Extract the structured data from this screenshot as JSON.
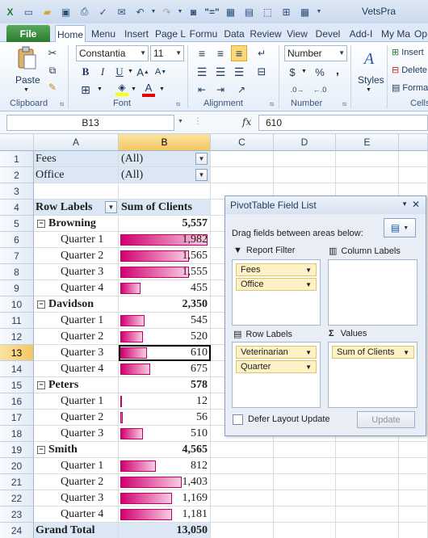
{
  "window": {
    "title": "VetsPra"
  },
  "tabs": [
    {
      "label": "File"
    },
    {
      "label": "Home"
    },
    {
      "label": "Menu"
    },
    {
      "label": "Insert"
    },
    {
      "label": "Page L"
    },
    {
      "label": "Formu"
    },
    {
      "label": "Data"
    },
    {
      "label": "Review"
    },
    {
      "label": "View"
    },
    {
      "label": "Devel"
    },
    {
      "label": "Add-I"
    },
    {
      "label": "My Ma"
    },
    {
      "label": "Op"
    }
  ],
  "ribbon": {
    "font_name": "Constantia",
    "font_size": "11",
    "number_format": "Number",
    "paste_label": "Paste",
    "styles_label": "Styles",
    "insert_label": "Insert",
    "delete_label": "Delete",
    "format_label": "Format",
    "groups": {
      "clipboard": "Clipboard",
      "font": "Font",
      "alignment": "Alignment",
      "number": "Number",
      "cells": "Cells"
    },
    "bold": "B",
    "italic": "I",
    "underline": "U",
    "percent": "%",
    "comma": ","
  },
  "formula_bar": {
    "name_box": "B13",
    "fx": "fx",
    "value": "610"
  },
  "columns": [
    "A",
    "B",
    "C",
    "D",
    "E"
  ],
  "rows": [
    "1",
    "2",
    "3",
    "4",
    "5",
    "6",
    "7",
    "8",
    "9",
    "10",
    "11",
    "12",
    "13",
    "14",
    "15",
    "16",
    "17",
    "18",
    "19",
    "20",
    "21",
    "22",
    "23",
    "24"
  ],
  "filters": [
    {
      "field": "Fees",
      "value": "(All)"
    },
    {
      "field": "Office",
      "value": "(All)"
    }
  ],
  "table": {
    "row_labels": "Row Labels",
    "sum_header": "Sum of Clients",
    "rows": [
      {
        "label": "Browning",
        "value": "5,557",
        "group": true
      },
      {
        "label": "Quarter 1",
        "value": "1,982",
        "frac": 1.0
      },
      {
        "label": "Quarter 2",
        "value": "1,565",
        "frac": 0.79
      },
      {
        "label": "Quarter 3",
        "value": "1,555",
        "frac": 0.785
      },
      {
        "label": "Quarter 4",
        "value": "455",
        "frac": 0.23
      },
      {
        "label": "Davidson",
        "value": "2,350",
        "group": true
      },
      {
        "label": "Quarter 1",
        "value": "545",
        "frac": 0.275
      },
      {
        "label": "Quarter 2",
        "value": "520",
        "frac": 0.262
      },
      {
        "label": "Quarter 3",
        "value": "610",
        "frac": 0.308
      },
      {
        "label": "Quarter 4",
        "value": "675",
        "frac": 0.341
      },
      {
        "label": "Peters",
        "value": "578",
        "group": true
      },
      {
        "label": "Quarter 1",
        "value": "12",
        "frac": 0.006
      },
      {
        "label": "Quarter 2",
        "value": "56",
        "frac": 0.028
      },
      {
        "label": "Quarter 3",
        "value": "510",
        "frac": 0.257
      },
      {
        "label": "Smith",
        "value": "4,565",
        "group": true
      },
      {
        "label": "Quarter 1",
        "value": "812",
        "frac": 0.41
      },
      {
        "label": "Quarter 2",
        "value": "1,403",
        "frac": 0.708
      },
      {
        "label": "Quarter 3",
        "value": "1,169",
        "frac": 0.59
      },
      {
        "label": "Quarter 4",
        "value": "1,181",
        "frac": 0.596
      }
    ],
    "grand_total_label": "Grand Total",
    "grand_total_value": "13,050"
  },
  "pivot_panel": {
    "title": "PivotTable Field List",
    "instructions": "Drag fields between areas below:",
    "report_filter": "Report Filter",
    "column_labels": "Column Labels",
    "row_labels": "Row Labels",
    "values": "Values",
    "report_filter_fields": [
      "Fees",
      "Office"
    ],
    "row_label_fields": [
      "Veterinarian",
      "Quarter"
    ],
    "value_fields": [
      "Sum of Clients"
    ],
    "defer_label": "Defer Layout Update",
    "update_label": "Update"
  },
  "colors": {
    "bar": "#d1006e",
    "header_fill": "#dbe7f5",
    "selection": "#f5c760"
  }
}
